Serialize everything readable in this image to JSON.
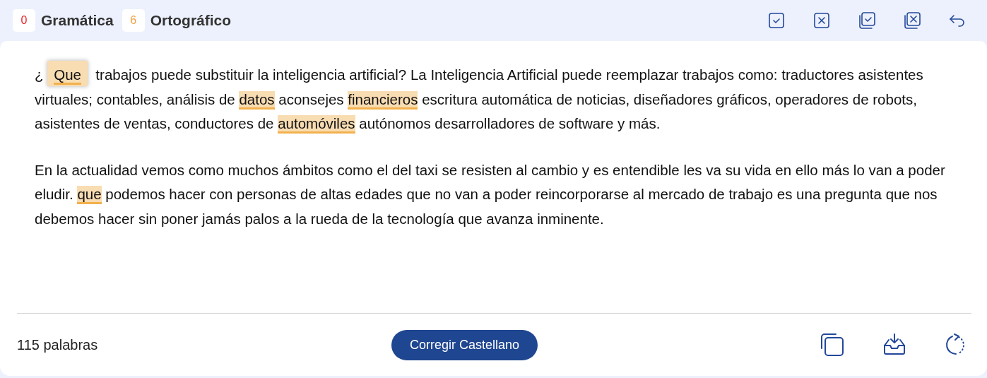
{
  "header": {
    "counters": [
      {
        "count": "0",
        "label": "Gramática",
        "color": "#e5262b"
      },
      {
        "count": "6",
        "label": "Ortográfico",
        "color": "#f0a040"
      }
    ],
    "actions": [
      {
        "kind": "accept"
      },
      {
        "kind": "reject"
      },
      {
        "kind": "accept-all"
      },
      {
        "kind": "reject-all"
      },
      {
        "kind": "undo"
      }
    ]
  },
  "paragraphs": [
    [
      {
        "text": "¿ "
      },
      {
        "text": "Que",
        "flagged": true,
        "selected": true
      },
      {
        "text": "  trabajos puede substituir la inteligencia artificial? La Inteligencia Artificial puede reemplazar trabajos como: traductores asistentes virtuales; contables, análisis de "
      },
      {
        "text": "datos",
        "flagged": true,
        "selected": false
      },
      {
        "text": " aconsejes "
      },
      {
        "text": "financieros",
        "flagged": true,
        "selected": false
      },
      {
        "text": " escritura automática de noticias, diseñadores gráficos, operadores de robots, asistentes de ventas, conductores de "
      },
      {
        "text": "automóviles",
        "flagged": true,
        "selected": false
      },
      {
        "text": " autónomos desarrolladores de software y más."
      }
    ],
    [
      {
        "text": "En la actualidad vemos como muchos ámbitos como el del taxi se resisten al cambio y es entendible les va su vida en ello más lo van a poder eludir. "
      },
      {
        "text": "que",
        "flagged": true,
        "selected": false
      },
      {
        "text": " podemos hacer con personas de altas edades que no van a poder reincorporarse al mercado de trabajo es una pregunta que nos debemos hacer sin poner jamás palos a la rueda de la tecnología que avanza inminente."
      }
    ]
  ],
  "footer": {
    "word_count": "115 palabras",
    "button": "Corregir Castellano",
    "actions": [
      {
        "kind": "copy"
      },
      {
        "kind": "download"
      },
      {
        "kind": "reload"
      }
    ]
  }
}
